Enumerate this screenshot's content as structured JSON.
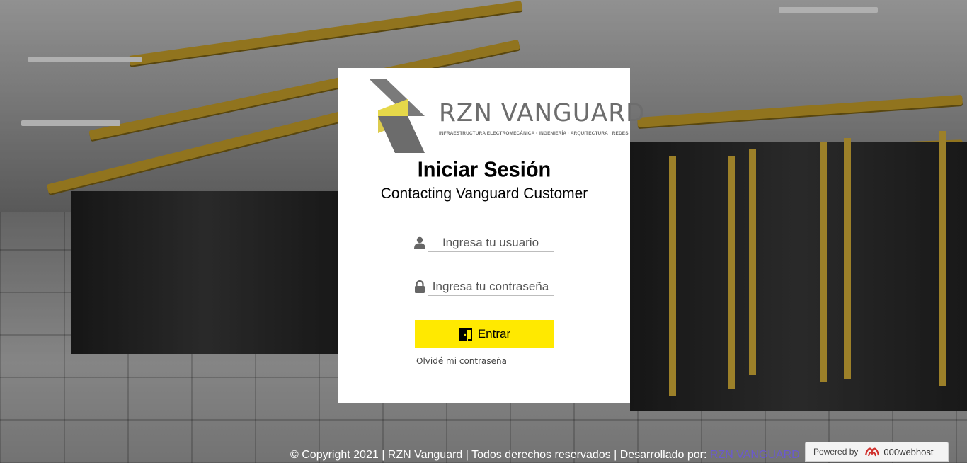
{
  "logo": {
    "name": "RZN VANGUARD",
    "tagline": "INFRAESTRUCTURA ELECTROMECÁNICA · INGENIERÍA · ARQUITECTURA · REDES"
  },
  "login": {
    "title": "Iniciar Sesión",
    "subtitle": "Contacting Vanguard Customer",
    "username_placeholder": "Ingresa tu usuario",
    "password_placeholder": "Ingresa tu contraseña",
    "submit_label": "Entrar",
    "forgot_label": "Olvidé mi contraseña"
  },
  "footer": {
    "copyright": "© Copyright 2021 | RZN Vanguard | Todos derechos reservados | Desarrollado por: ",
    "developer_link": "RZN VANGUARD"
  },
  "badge": {
    "powered_by": "Powered by",
    "brand": "000webhost"
  },
  "colors": {
    "accent_yellow": "#ffe900",
    "card_bg": "#ffffff",
    "link_purple": "#6a5acd"
  },
  "icons": [
    "user-icon",
    "lock-icon",
    "door-exit-icon",
    "webhost-logo-icon"
  ]
}
